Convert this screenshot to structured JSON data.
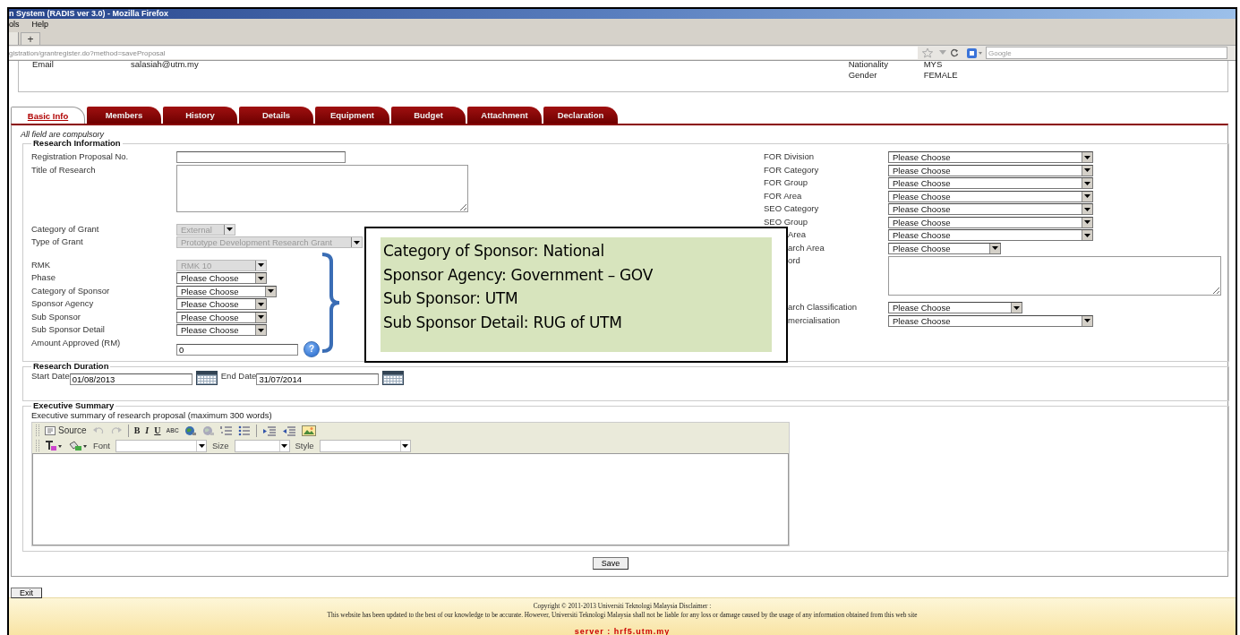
{
  "window": {
    "title": "n System (RADIS ver 3.0) - Mozilla Firefox"
  },
  "menu": [
    "ols",
    "Help"
  ],
  "browser_tabs": {
    "new_tab": "+"
  },
  "address_bar": {
    "url": "gistration/grantregister.do?method=saveProposal"
  },
  "search": {
    "placeholder": "Google"
  },
  "profile": {
    "left": [
      {
        "label": "Email",
        "value": "salasiah@utm.my"
      }
    ],
    "right": [
      {
        "label": "Nationality",
        "value": "MYS"
      },
      {
        "label": "Gender",
        "value": "FEMALE"
      }
    ]
  },
  "tabs": [
    {
      "label": "Basic Info",
      "selected": true
    },
    {
      "label": "Members",
      "selected": false
    },
    {
      "label": "History",
      "selected": false
    },
    {
      "label": "Details",
      "selected": false
    },
    {
      "label": "Equipment",
      "selected": false
    },
    {
      "label": "Budget",
      "selected": false
    },
    {
      "label": "Attachment",
      "selected": false
    },
    {
      "label": "Declaration",
      "selected": false
    }
  ],
  "note": "All field are compulsory",
  "research_information": {
    "legend": "Research Information",
    "left_fields": [
      {
        "label": "Registration Proposal No.",
        "kind": "text"
      },
      {
        "label": "Title of Research",
        "kind": "textarea"
      },
      {
        "label": "Category of Grant",
        "kind": "select",
        "value": "External",
        "disabled": true
      },
      {
        "label": "Type of Grant",
        "kind": "select",
        "value": "Prototype Development Research Grant",
        "disabled": true
      },
      {
        "label": "RMK",
        "kind": "select",
        "value": "RMK 10",
        "disabled": true
      },
      {
        "label": "Phase",
        "kind": "select",
        "value": "Please Choose",
        "disabled": false
      },
      {
        "label": "Category of Sponsor",
        "kind": "select",
        "value": "Please Choose",
        "disabled": false
      },
      {
        "label": "Sponsor Agency",
        "kind": "select",
        "value": "Please Choose",
        "disabled": false
      },
      {
        "label": "Sub Sponsor",
        "kind": "select",
        "value": "Please Choose",
        "disabled": false
      },
      {
        "label": "Sub Sponsor Detail",
        "kind": "select",
        "value": "Please Choose",
        "disabled": false
      },
      {
        "label": "Amount Approved (RM)",
        "kind": "amount",
        "value": "0",
        "help": "?"
      }
    ],
    "right_fields": [
      {
        "label": "FOR Division",
        "kind": "select",
        "value": "Please Choose",
        "covered": false
      },
      {
        "label": "FOR Category",
        "kind": "select",
        "value": "Please Choose",
        "covered": false
      },
      {
        "label": "FOR Group",
        "kind": "select",
        "value": "Please Choose",
        "covered": false
      },
      {
        "label": "FOR Area",
        "kind": "select",
        "value": "Please Choose",
        "covered": false
      },
      {
        "label": "SEO Category",
        "kind": "select",
        "value": "Please Choose",
        "covered": false
      },
      {
        "label": "SEO Group",
        "kind": "select",
        "value": "Please Choose",
        "covered": false
      },
      {
        "label": "Area",
        "kind": "select",
        "value": "Please Choose",
        "covered": true
      },
      {
        "label": "arch Area",
        "kind": "select",
        "value": "Please Choose",
        "covered": true
      },
      {
        "label": "ord",
        "kind": "textarea",
        "covered": true
      },
      {
        "label": "arch Classification",
        "kind": "select",
        "value": "Please Choose",
        "covered": true
      },
      {
        "label": "mercialisation",
        "kind": "select",
        "value": "Please Choose",
        "covered": true
      }
    ]
  },
  "callout": {
    "lines": [
      "Category of Sponsor: National",
      "Sponsor Agency: Government – GOV",
      "Sub Sponsor: UTM",
      "Sub Sponsor Detail: RUG of UTM"
    ]
  },
  "research_duration": {
    "legend": "Research Duration",
    "fields": [
      {
        "label": "Start Date",
        "value": "01/08/2013"
      },
      {
        "label": "End Date",
        "value": "31/07/2014"
      }
    ]
  },
  "executive_summary": {
    "legend": "Executive Summary",
    "hint": "Executive summary of research proposal (maximum 300 words)",
    "toolbar": [
      {
        "kind": "source",
        "label": "Source"
      },
      {
        "kind": "undo"
      },
      {
        "kind": "redo"
      },
      {
        "kind": "separator"
      },
      {
        "kind": "bold",
        "label": "B"
      },
      {
        "kind": "italic",
        "label": "I"
      },
      {
        "kind": "underline",
        "label": "U"
      },
      {
        "kind": "spell",
        "label": "ABC"
      },
      {
        "kind": "link"
      },
      {
        "kind": "unlink"
      },
      {
        "kind": "numbered-list"
      },
      {
        "kind": "bulleted-list"
      },
      {
        "kind": "separator"
      },
      {
        "kind": "outdent"
      },
      {
        "kind": "indent"
      },
      {
        "kind": "image"
      }
    ],
    "toolbar2": [
      {
        "kind": "text-color"
      },
      {
        "kind": "bg-color"
      },
      {
        "kind": "combo",
        "label": "Font"
      },
      {
        "kind": "combo",
        "label": "Size"
      },
      {
        "kind": "combo",
        "label": "Style"
      }
    ]
  },
  "save": "Save",
  "exit": "Exit",
  "footer": {
    "copyright": "Copyright © 2011-2013 Universiti Teknologi Malaysia Disclaimer :",
    "disclaimer": "This website has been updated to the best of our knowledge to be accurate. However, Universiti Teknologi Malaysia shall not be liable for any loss or damage caused by the usage of any information obtained from this web site",
    "server": "server : hrf5.utm.my"
  }
}
